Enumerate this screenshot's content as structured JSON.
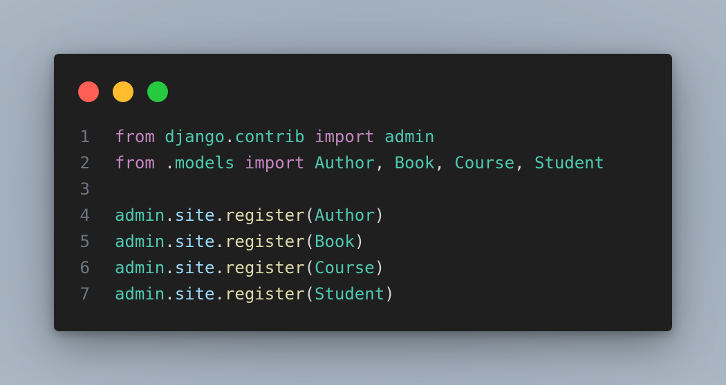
{
  "window": {
    "controls": [
      {
        "name": "close",
        "color": "#ff5f56"
      },
      {
        "name": "minimize",
        "color": "#ffbd2e"
      },
      {
        "name": "maximize",
        "color": "#27c93f"
      }
    ]
  },
  "code": {
    "lines": [
      {
        "num": "1",
        "tokens": [
          {
            "t": "from",
            "c": "kw"
          },
          {
            "t": " ",
            "c": "punc"
          },
          {
            "t": "django",
            "c": "mod"
          },
          {
            "t": ".",
            "c": "punc"
          },
          {
            "t": "contrib",
            "c": "mod"
          },
          {
            "t": " ",
            "c": "punc"
          },
          {
            "t": "import",
            "c": "kw"
          },
          {
            "t": " ",
            "c": "punc"
          },
          {
            "t": "admin",
            "c": "mod"
          }
        ]
      },
      {
        "num": "2",
        "tokens": [
          {
            "t": "from",
            "c": "kw"
          },
          {
            "t": " ",
            "c": "punc"
          },
          {
            "t": ".",
            "c": "punc"
          },
          {
            "t": "models",
            "c": "mod"
          },
          {
            "t": " ",
            "c": "punc"
          },
          {
            "t": "import",
            "c": "kw"
          },
          {
            "t": " ",
            "c": "punc"
          },
          {
            "t": "Author",
            "c": "cls"
          },
          {
            "t": ", ",
            "c": "punc"
          },
          {
            "t": "Book",
            "c": "cls"
          },
          {
            "t": ", ",
            "c": "punc"
          },
          {
            "t": "Course",
            "c": "cls"
          },
          {
            "t": ", ",
            "c": "punc"
          },
          {
            "t": "Student",
            "c": "cls"
          }
        ]
      },
      {
        "num": "3",
        "tokens": []
      },
      {
        "num": "4",
        "tokens": [
          {
            "t": "admin",
            "c": "var"
          },
          {
            "t": ".",
            "c": "punc"
          },
          {
            "t": "site",
            "c": "attr"
          },
          {
            "t": ".",
            "c": "punc"
          },
          {
            "t": "register",
            "c": "fn"
          },
          {
            "t": "(",
            "c": "punc"
          },
          {
            "t": "Author",
            "c": "cls"
          },
          {
            "t": ")",
            "c": "punc"
          }
        ]
      },
      {
        "num": "5",
        "tokens": [
          {
            "t": "admin",
            "c": "var"
          },
          {
            "t": ".",
            "c": "punc"
          },
          {
            "t": "site",
            "c": "attr"
          },
          {
            "t": ".",
            "c": "punc"
          },
          {
            "t": "register",
            "c": "fn"
          },
          {
            "t": "(",
            "c": "punc"
          },
          {
            "t": "Book",
            "c": "cls"
          },
          {
            "t": ")",
            "c": "punc"
          }
        ]
      },
      {
        "num": "6",
        "tokens": [
          {
            "t": "admin",
            "c": "var"
          },
          {
            "t": ".",
            "c": "punc"
          },
          {
            "t": "site",
            "c": "attr"
          },
          {
            "t": ".",
            "c": "punc"
          },
          {
            "t": "register",
            "c": "fn"
          },
          {
            "t": "(",
            "c": "punc"
          },
          {
            "t": "Course",
            "c": "cls"
          },
          {
            "t": ")",
            "c": "punc"
          }
        ]
      },
      {
        "num": "7",
        "tokens": [
          {
            "t": "admin",
            "c": "var"
          },
          {
            "t": ".",
            "c": "punc"
          },
          {
            "t": "site",
            "c": "attr"
          },
          {
            "t": ".",
            "c": "punc"
          },
          {
            "t": "register",
            "c": "fn"
          },
          {
            "t": "(",
            "c": "punc"
          },
          {
            "t": "Student",
            "c": "cls"
          },
          {
            "t": ")",
            "c": "punc"
          }
        ]
      }
    ]
  }
}
